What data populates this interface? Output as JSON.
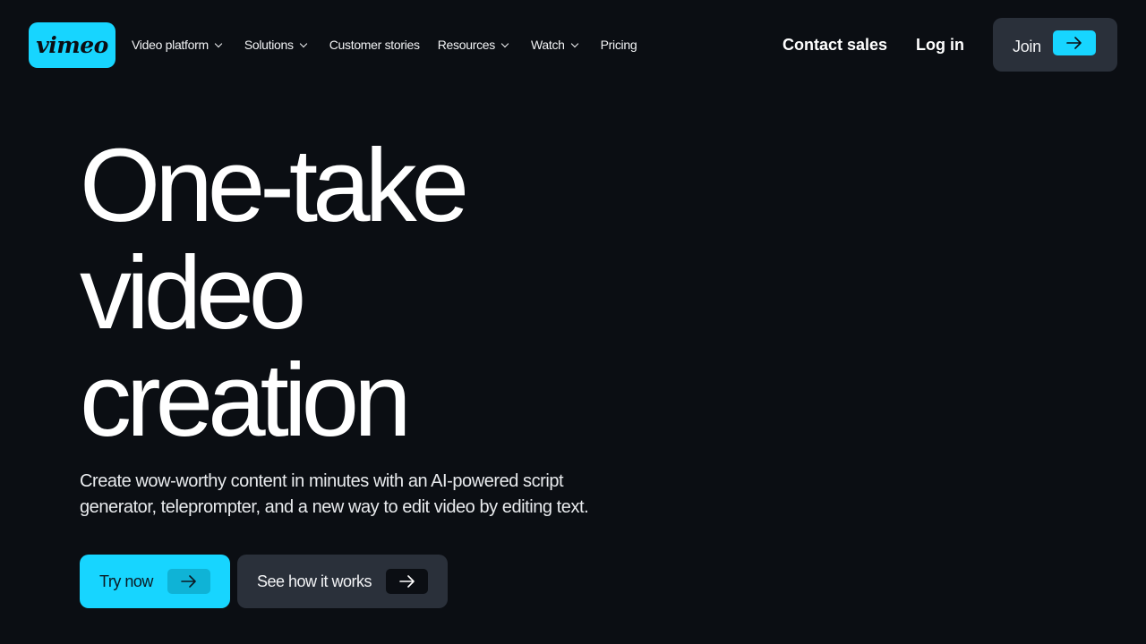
{
  "brand": {
    "logo_text": "vimeo",
    "accent_color": "#17d5ff",
    "background_color": "#0b0e13",
    "surface_color": "#2a303a"
  },
  "nav": {
    "items": [
      {
        "label": "Video platform",
        "has_dropdown": true
      },
      {
        "label": "Solutions",
        "has_dropdown": true
      },
      {
        "label": "Customer stories",
        "has_dropdown": false
      },
      {
        "label": "Resources",
        "has_dropdown": true
      },
      {
        "label": "Watch",
        "has_dropdown": true
      },
      {
        "label": "Pricing",
        "has_dropdown": false
      }
    ],
    "contact_sales": "Contact sales",
    "log_in": "Log in",
    "join": "Join",
    "join_icon": "arrow-right-icon"
  },
  "hero": {
    "title_lines": [
      "One-take",
      "video",
      "creation"
    ],
    "subtitle": "Create wow-worthy content in minutes with an AI-powered script generator, teleprompter, and a new way to edit video by editing text.",
    "primary_cta": "Try now",
    "secondary_cta": "See how it works",
    "cta_icon": "arrow-right-icon"
  }
}
